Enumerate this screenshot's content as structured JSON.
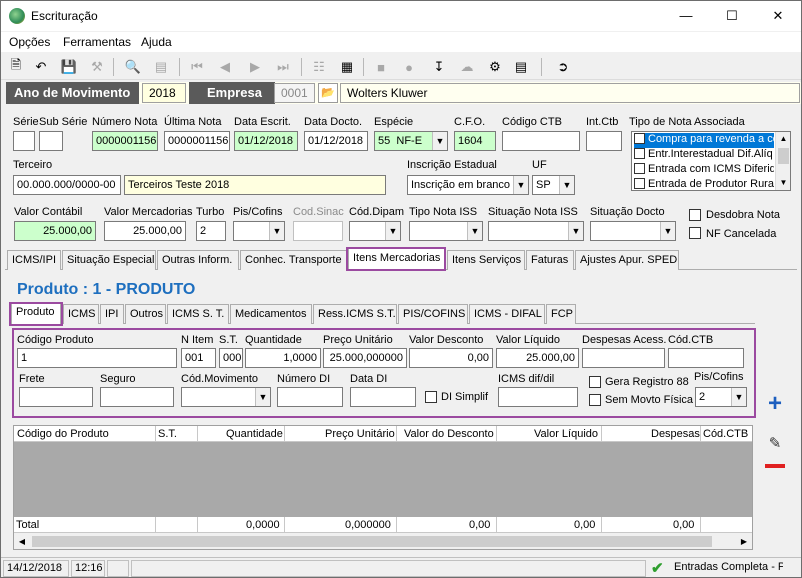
{
  "window": {
    "title": "Escrituração"
  },
  "menu": {
    "opcoes": "Opções",
    "ferramentas": "Ferramentas",
    "ajuda": "Ajuda"
  },
  "header": {
    "ano_label": "Ano de Movimento",
    "ano_value": "2018",
    "empresa_label": "Empresa",
    "empresa_code": "0001",
    "empresa_name": "Wolters Kluwer"
  },
  "nota": {
    "serie_label": "Série",
    "subserie_label": "Sub Série",
    "numero_label": "Número Nota",
    "numero_value": "0000001156",
    "ultima_label": "Última Nota",
    "ultima_value": "0000001156",
    "data_escrit_label": "Data Escrit.",
    "data_escrit_value": "01/12/2018",
    "data_docto_label": "Data Docto.",
    "data_docto_value": "01/12/2018",
    "especie_label": "Espécie",
    "especie_code": "55",
    "especie_value": "NF-E",
    "cfo_label": "C.F.O.",
    "cfo_value": "1604",
    "codigo_ctb_label": "Código CTB",
    "int_ctb_label": "Int.Ctb",
    "tipo_nota_label": "Tipo de Nota Associada",
    "tipo_nota_items": [
      "Compra para revenda a co",
      "Entr.Interestadual Dif.Alíq",
      "Entrada com ICMS Diferido",
      "Entrada de Produtor Rural"
    ],
    "terceiro_label": "Terceiro",
    "terceiro_doc": "00.000.000/0000-00",
    "terceiro_name": "Terceiros Teste 2018",
    "inscricao_label": "Inscrição Estadual",
    "inscricao_value": "Inscrição em branco",
    "uf_label": "UF",
    "uf_value": "SP",
    "valor_contabil_label": "Valor Contábil",
    "valor_contabil_value": "25.000,00",
    "valor_mercadorias_label": "Valor Mercadorias",
    "valor_mercadorias_value": "25.000,00",
    "turbo_label": "Turbo",
    "turbo_value": "2",
    "pis_cofins_label": "Pis/Cofins",
    "cod_sinac_label": "Cod.Sinac",
    "cod_dipam_label": "Cód.Dipam",
    "tipo_iss_label": "Tipo Nota ISS",
    "situacao_iss_label": "Situação Nota ISS",
    "situacao_docto_label": "Situação Docto",
    "desdobra_label": "Desdobra Nota",
    "nf_cancelada_label": "NF Cancelada"
  },
  "main_tabs": [
    "ICMS/IPI",
    "Situação Especial",
    "Outras Inform.",
    "Conhec. Transporte",
    "Itens Mercadorias",
    "Itens Serviços",
    "Faturas",
    "Ajustes Apur. SPED"
  ],
  "produto_title": "Produto : 1 - PRODUTO",
  "sub_tabs": [
    "Produto",
    "ICMS",
    "IPI",
    "Outros",
    "ICMS S. T.",
    "Medicamentos",
    "Ress.ICMS S.T.",
    "PIS/COFINS",
    "ICMS - DIFAL",
    "FCP"
  ],
  "produto": {
    "codigo_label": "Código Produto",
    "codigo_value": "1",
    "n_item_label": "N Item",
    "n_item_value": "001",
    "st_label": "S.T.",
    "st_value": "000",
    "quantidade_label": "Quantidade",
    "quantidade_value": "1,0000",
    "preco_label": "Preço Unitário",
    "preco_value": "25.000,000000",
    "desconto_label": "Valor Desconto",
    "desconto_value": "0,00",
    "liquido_label": "Valor Líquido",
    "liquido_value": "25.000,00",
    "despesas_label": "Despesas Acess.",
    "cod_ctb_label": "Cód.CTB",
    "frete_label": "Frete",
    "seguro_label": "Seguro",
    "cod_mov_label": "Cód.Movimento",
    "numero_di_label": "Número DI",
    "data_di_label": "Data DI",
    "di_simplif_label": "DI Simplif",
    "icms_dif_label": "ICMS dif/dil",
    "gera_registro_label": "Gera Registro 88",
    "sem_movto_label": "Sem Movto Física",
    "pis_cofins_label": "Pis/Cofins",
    "pis_cofins_value": "2"
  },
  "grid": {
    "columns": [
      "Código do Produto",
      "S.T.",
      "Quantidade",
      "Preço Unitário",
      "Valor do Desconto",
      "Valor Líquido",
      "Despesas",
      "Cód.CTB"
    ],
    "total_label": "Total",
    "totals": [
      "0,0000",
      "0,000000",
      "0,00",
      "0,00",
      "0,00"
    ]
  },
  "status": {
    "date": "14/12/2018",
    "time": "12:16",
    "message": "Entradas Completa - P"
  },
  "colors": {
    "accent_title": "#1e6fbf",
    "highlight": "#9b4aa0",
    "field_green": "#ccffcc",
    "field_yellow": "#ffffe0"
  }
}
